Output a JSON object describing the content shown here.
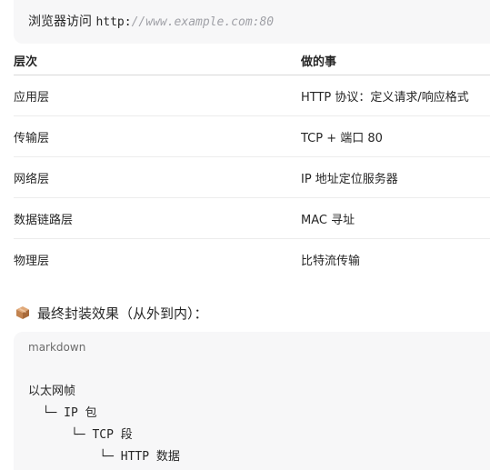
{
  "top_code": {
    "label": "浏览器访问",
    "url_prefix": "http:",
    "url_comment": "//www.example.com:80"
  },
  "table": {
    "headers": [
      "层次",
      "做的事"
    ],
    "rows": [
      [
        "应用层",
        "HTTP 协议：定义请求/响应格式"
      ],
      [
        "传输层",
        "TCP + 端口 80"
      ],
      [
        "网络层",
        "IP 地址定位服务器"
      ],
      [
        "数据链路层",
        "MAC 寻址"
      ],
      [
        "物理层",
        "比特流传输"
      ]
    ]
  },
  "encapsulation": {
    "icon": "package-icon",
    "heading": "最终封装效果（从外到内）："
  },
  "code_block": {
    "language": "markdown",
    "lines": [
      "以太网帧",
      "  └─ IP 包",
      "      └─ TCP 段",
      "          └─ HTTP 数据"
    ]
  }
}
